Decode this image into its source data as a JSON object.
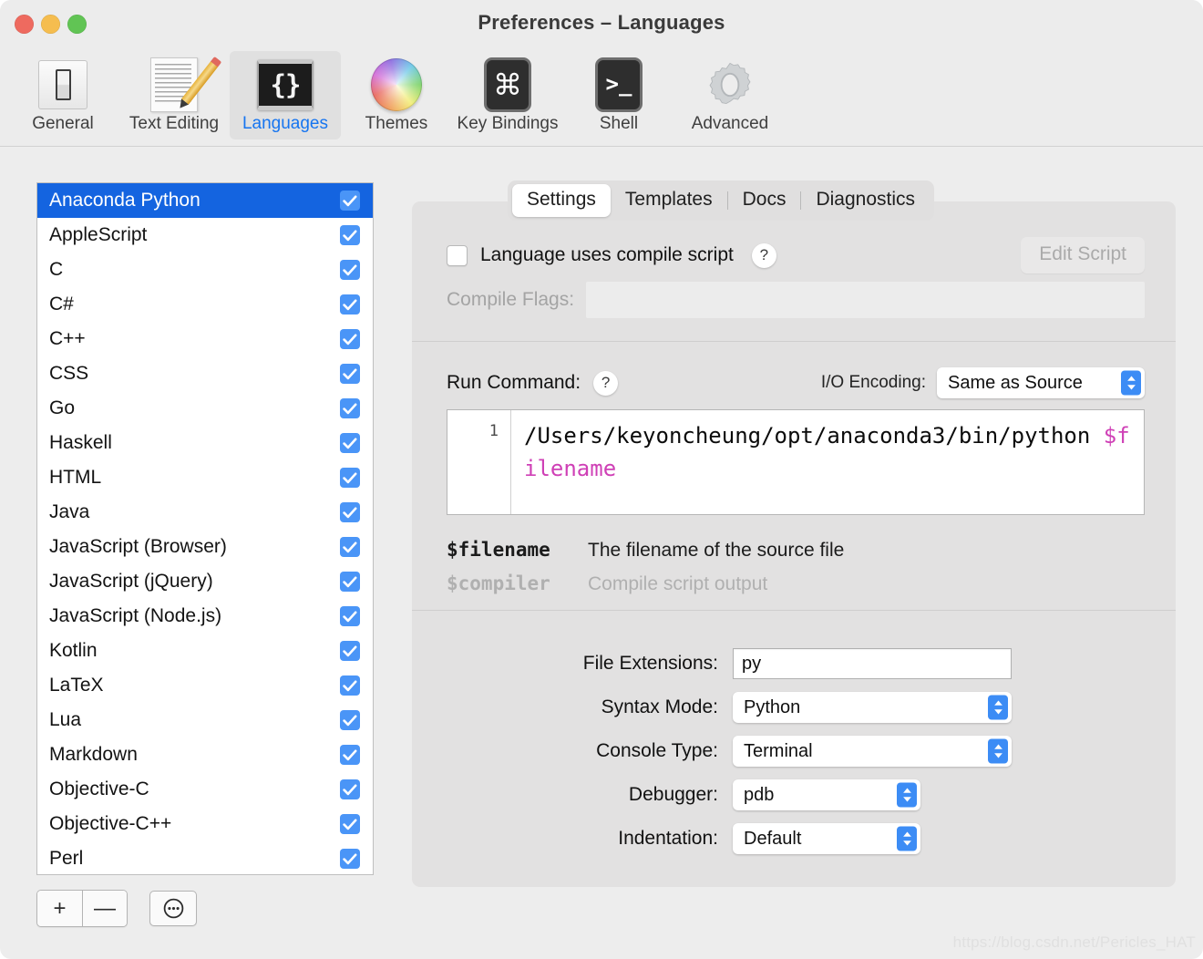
{
  "window": {
    "title": "Preferences – Languages",
    "traffic_lights": [
      "close",
      "minimize",
      "zoom"
    ]
  },
  "toolbar": {
    "items": [
      {
        "label": "General",
        "icon": "switch-icon",
        "selected": false
      },
      {
        "label": "Text Editing",
        "icon": "page-pencil-icon",
        "selected": false
      },
      {
        "label": "Languages",
        "icon": "braces-screen-icon",
        "selected": true
      },
      {
        "label": "Themes",
        "icon": "color-wheel-icon",
        "selected": false
      },
      {
        "label": "Key Bindings",
        "icon": "command-key-icon",
        "selected": false
      },
      {
        "label": "Shell",
        "icon": "terminal-prompt-icon",
        "selected": false
      },
      {
        "label": "Advanced",
        "icon": "gear-icon",
        "selected": false
      }
    ]
  },
  "language_list": {
    "items": [
      {
        "name": "Anaconda Python",
        "enabled": true,
        "selected": true
      },
      {
        "name": "AppleScript",
        "enabled": true,
        "selected": false
      },
      {
        "name": "C",
        "enabled": true,
        "selected": false
      },
      {
        "name": "C#",
        "enabled": true,
        "selected": false
      },
      {
        "name": "C++",
        "enabled": true,
        "selected": false
      },
      {
        "name": "CSS",
        "enabled": true,
        "selected": false
      },
      {
        "name": "Go",
        "enabled": true,
        "selected": false
      },
      {
        "name": "Haskell",
        "enabled": true,
        "selected": false
      },
      {
        "name": "HTML",
        "enabled": true,
        "selected": false
      },
      {
        "name": "Java",
        "enabled": true,
        "selected": false
      },
      {
        "name": "JavaScript (Browser)",
        "enabled": true,
        "selected": false
      },
      {
        "name": "JavaScript (jQuery)",
        "enabled": true,
        "selected": false
      },
      {
        "name": "JavaScript (Node.js)",
        "enabled": true,
        "selected": false
      },
      {
        "name": "Kotlin",
        "enabled": true,
        "selected": false
      },
      {
        "name": "LaTeX",
        "enabled": true,
        "selected": false
      },
      {
        "name": "Lua",
        "enabled": true,
        "selected": false
      },
      {
        "name": "Markdown",
        "enabled": true,
        "selected": false
      },
      {
        "name": "Objective-C",
        "enabled": true,
        "selected": false
      },
      {
        "name": "Objective-C++",
        "enabled": true,
        "selected": false
      },
      {
        "name": "Perl",
        "enabled": true,
        "selected": false
      }
    ],
    "buttons": {
      "add": "+",
      "remove": "—",
      "more": "•••"
    }
  },
  "tabs": [
    {
      "label": "Settings",
      "active": true
    },
    {
      "label": "Templates",
      "active": false
    },
    {
      "label": "Docs",
      "active": false
    },
    {
      "label": "Diagnostics",
      "active": false
    }
  ],
  "settings": {
    "compile_script": {
      "checkbox_label": "Language uses compile script",
      "checked": false,
      "help": "?",
      "edit_button": "Edit Script",
      "edit_button_disabled": true
    },
    "compile_flags": {
      "label": "Compile Flags:",
      "value": "",
      "disabled": true
    },
    "run_command": {
      "label": "Run Command:",
      "help": "?",
      "line_number": "1",
      "command_path": "/Users/keyoncheung/opt/anaconda3/bin/python ",
      "command_variable": "$filename",
      "variable_color": "#cf40b6"
    },
    "io_encoding": {
      "label": "I/O Encoding:",
      "value": "Same as Source"
    },
    "variables": [
      {
        "key": "$filename",
        "description": "The filename of the source file",
        "muted": false
      },
      {
        "key": "$compiler",
        "description": "Compile script output",
        "muted": true
      }
    ],
    "fields": {
      "file_extensions": {
        "label": "File Extensions:",
        "value": "py"
      },
      "syntax_mode": {
        "label": "Syntax Mode:",
        "value": "Python"
      },
      "console_type": {
        "label": "Console Type:",
        "value": "Terminal"
      },
      "debugger": {
        "label": "Debugger:",
        "value": "pdb"
      },
      "indentation": {
        "label": "Indentation:",
        "value": "Default"
      }
    }
  },
  "watermark": "https://blog.csdn.net/Pericles_HAT",
  "colors": {
    "accent_blue": "#1464e0",
    "checkbox_blue": "#4a95f7",
    "stepper_blue": "#3c8cf5",
    "tab_selected_text": "#1675f0",
    "variable_magenta": "#cf40b6",
    "window_bg": "#ededed",
    "panel_bg": "#e2e1e1"
  }
}
